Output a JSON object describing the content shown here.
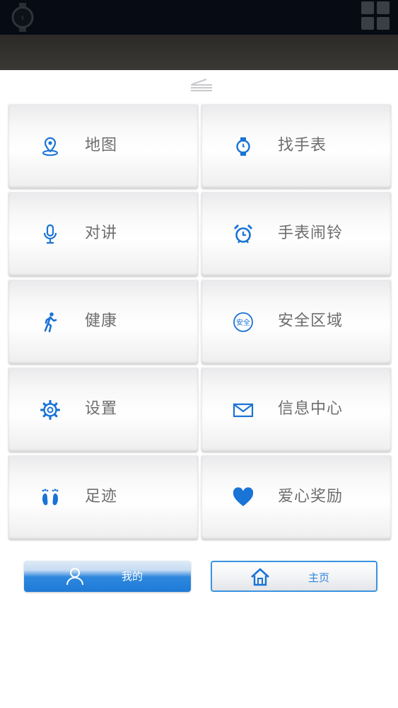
{
  "colors": {
    "accent": "#1a73d6",
    "label_text": "#6d6d6d",
    "topbar_bg": "#060b14",
    "subbar_bg": "#353330"
  },
  "header": {
    "logo_icon": "watch-logo-icon",
    "menu_icon": "grid-menu-icon"
  },
  "tiles": [
    {
      "label": "地图",
      "icon": "map-pin-icon"
    },
    {
      "label": "找手表",
      "icon": "watch-icon"
    },
    {
      "label": "对讲",
      "icon": "microphone-icon"
    },
    {
      "label": "手表闹铃",
      "icon": "alarm-clock-icon"
    },
    {
      "label": "健康",
      "icon": "running-person-icon"
    },
    {
      "label": "安全区域",
      "icon": "safety-badge-icon",
      "icon_text": "安全"
    },
    {
      "label": "设置",
      "icon": "gear-icon"
    },
    {
      "label": "信息中心",
      "icon": "envelope-icon"
    },
    {
      "label": "足迹",
      "icon": "footprints-icon"
    },
    {
      "label": "爱心奖励",
      "icon": "heart-icon"
    }
  ],
  "bottom_nav": {
    "mine_label": "我的",
    "mine_icon": "user-icon",
    "home_label": "主页",
    "home_icon": "home-icon"
  }
}
